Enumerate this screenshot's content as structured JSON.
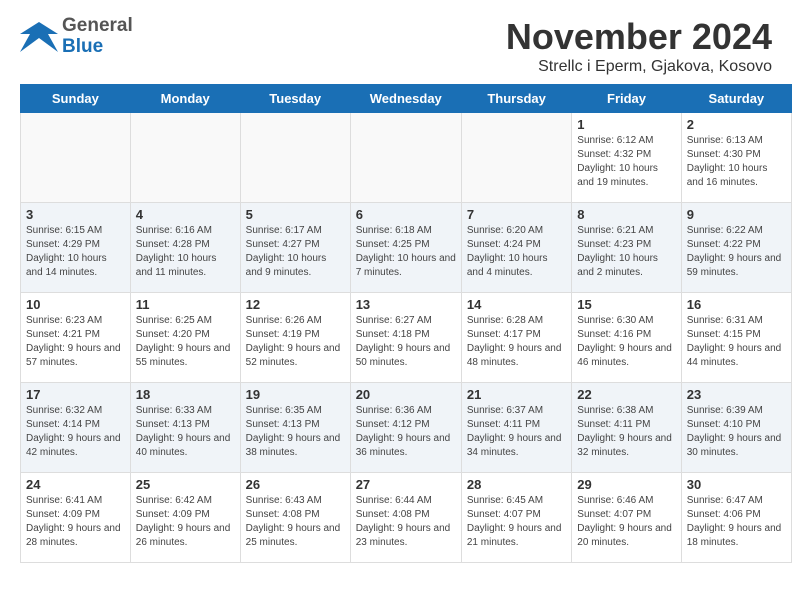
{
  "header": {
    "logo_general": "General",
    "logo_blue": "Blue",
    "main_title": "November 2024",
    "subtitle": "Strellc i Eperm, Gjakova, Kosovo"
  },
  "days_of_week": [
    "Sunday",
    "Monday",
    "Tuesday",
    "Wednesday",
    "Thursday",
    "Friday",
    "Saturday"
  ],
  "weeks": [
    {
      "row_alt": false,
      "days": [
        {
          "num": "",
          "info": ""
        },
        {
          "num": "",
          "info": ""
        },
        {
          "num": "",
          "info": ""
        },
        {
          "num": "",
          "info": ""
        },
        {
          "num": "",
          "info": ""
        },
        {
          "num": "1",
          "info": "Sunrise: 6:12 AM\nSunset: 4:32 PM\nDaylight: 10 hours and 19 minutes."
        },
        {
          "num": "2",
          "info": "Sunrise: 6:13 AM\nSunset: 4:30 PM\nDaylight: 10 hours and 16 minutes."
        }
      ]
    },
    {
      "row_alt": true,
      "days": [
        {
          "num": "3",
          "info": "Sunrise: 6:15 AM\nSunset: 4:29 PM\nDaylight: 10 hours and 14 minutes."
        },
        {
          "num": "4",
          "info": "Sunrise: 6:16 AM\nSunset: 4:28 PM\nDaylight: 10 hours and 11 minutes."
        },
        {
          "num": "5",
          "info": "Sunrise: 6:17 AM\nSunset: 4:27 PM\nDaylight: 10 hours and 9 minutes."
        },
        {
          "num": "6",
          "info": "Sunrise: 6:18 AM\nSunset: 4:25 PM\nDaylight: 10 hours and 7 minutes."
        },
        {
          "num": "7",
          "info": "Sunrise: 6:20 AM\nSunset: 4:24 PM\nDaylight: 10 hours and 4 minutes."
        },
        {
          "num": "8",
          "info": "Sunrise: 6:21 AM\nSunset: 4:23 PM\nDaylight: 10 hours and 2 minutes."
        },
        {
          "num": "9",
          "info": "Sunrise: 6:22 AM\nSunset: 4:22 PM\nDaylight: 9 hours and 59 minutes."
        }
      ]
    },
    {
      "row_alt": false,
      "days": [
        {
          "num": "10",
          "info": "Sunrise: 6:23 AM\nSunset: 4:21 PM\nDaylight: 9 hours and 57 minutes."
        },
        {
          "num": "11",
          "info": "Sunrise: 6:25 AM\nSunset: 4:20 PM\nDaylight: 9 hours and 55 minutes."
        },
        {
          "num": "12",
          "info": "Sunrise: 6:26 AM\nSunset: 4:19 PM\nDaylight: 9 hours and 52 minutes."
        },
        {
          "num": "13",
          "info": "Sunrise: 6:27 AM\nSunset: 4:18 PM\nDaylight: 9 hours and 50 minutes."
        },
        {
          "num": "14",
          "info": "Sunrise: 6:28 AM\nSunset: 4:17 PM\nDaylight: 9 hours and 48 minutes."
        },
        {
          "num": "15",
          "info": "Sunrise: 6:30 AM\nSunset: 4:16 PM\nDaylight: 9 hours and 46 minutes."
        },
        {
          "num": "16",
          "info": "Sunrise: 6:31 AM\nSunset: 4:15 PM\nDaylight: 9 hours and 44 minutes."
        }
      ]
    },
    {
      "row_alt": true,
      "days": [
        {
          "num": "17",
          "info": "Sunrise: 6:32 AM\nSunset: 4:14 PM\nDaylight: 9 hours and 42 minutes."
        },
        {
          "num": "18",
          "info": "Sunrise: 6:33 AM\nSunset: 4:13 PM\nDaylight: 9 hours and 40 minutes."
        },
        {
          "num": "19",
          "info": "Sunrise: 6:35 AM\nSunset: 4:13 PM\nDaylight: 9 hours and 38 minutes."
        },
        {
          "num": "20",
          "info": "Sunrise: 6:36 AM\nSunset: 4:12 PM\nDaylight: 9 hours and 36 minutes."
        },
        {
          "num": "21",
          "info": "Sunrise: 6:37 AM\nSunset: 4:11 PM\nDaylight: 9 hours and 34 minutes."
        },
        {
          "num": "22",
          "info": "Sunrise: 6:38 AM\nSunset: 4:11 PM\nDaylight: 9 hours and 32 minutes."
        },
        {
          "num": "23",
          "info": "Sunrise: 6:39 AM\nSunset: 4:10 PM\nDaylight: 9 hours and 30 minutes."
        }
      ]
    },
    {
      "row_alt": false,
      "days": [
        {
          "num": "24",
          "info": "Sunrise: 6:41 AM\nSunset: 4:09 PM\nDaylight: 9 hours and 28 minutes."
        },
        {
          "num": "25",
          "info": "Sunrise: 6:42 AM\nSunset: 4:09 PM\nDaylight: 9 hours and 26 minutes."
        },
        {
          "num": "26",
          "info": "Sunrise: 6:43 AM\nSunset: 4:08 PM\nDaylight: 9 hours and 25 minutes."
        },
        {
          "num": "27",
          "info": "Sunrise: 6:44 AM\nSunset: 4:08 PM\nDaylight: 9 hours and 23 minutes."
        },
        {
          "num": "28",
          "info": "Sunrise: 6:45 AM\nSunset: 4:07 PM\nDaylight: 9 hours and 21 minutes."
        },
        {
          "num": "29",
          "info": "Sunrise: 6:46 AM\nSunset: 4:07 PM\nDaylight: 9 hours and 20 minutes."
        },
        {
          "num": "30",
          "info": "Sunrise: 6:47 AM\nSunset: 4:06 PM\nDaylight: 9 hours and 18 minutes."
        }
      ]
    }
  ]
}
